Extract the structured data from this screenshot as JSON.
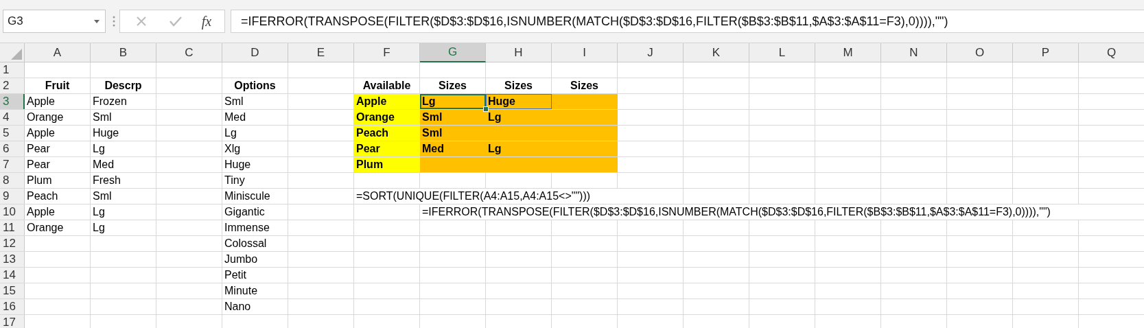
{
  "name_box": {
    "value": "G3"
  },
  "formula_bar": {
    "fx_label": "fx",
    "value": "=IFERROR(TRANSPOSE(FILTER($D$3:$D$16,ISNUMBER(MATCH($D$3:$D$16,FILTER($B$3:$B$11,$A$3:$A$11=F3),0)))),\"\")"
  },
  "columns": [
    {
      "label": "A",
      "selected": false
    },
    {
      "label": "B",
      "selected": false
    },
    {
      "label": "C",
      "selected": false
    },
    {
      "label": "D",
      "selected": false
    },
    {
      "label": "E",
      "selected": false
    },
    {
      "label": "F",
      "selected": false
    },
    {
      "label": "G",
      "selected": true
    },
    {
      "label": "H",
      "selected": false
    },
    {
      "label": "I",
      "selected": false
    },
    {
      "label": "J",
      "selected": false
    },
    {
      "label": "K",
      "selected": false
    },
    {
      "label": "L",
      "selected": false
    },
    {
      "label": "M",
      "selected": false
    },
    {
      "label": "N",
      "selected": false
    },
    {
      "label": "O",
      "selected": false
    },
    {
      "label": "P",
      "selected": false
    },
    {
      "label": "Q",
      "selected": false
    }
  ],
  "rows": [
    {
      "number": "1",
      "selected": false,
      "cells": [
        null,
        null,
        null,
        null,
        null,
        null,
        null,
        null,
        null,
        null,
        null,
        null,
        null,
        null,
        null,
        null,
        null
      ]
    },
    {
      "number": "2",
      "selected": false,
      "cells": [
        {
          "text": "Fruit",
          "bold": true,
          "centered": true
        },
        {
          "text": "Descrp",
          "bold": true,
          "centered": true
        },
        null,
        {
          "text": "Options",
          "bold": true,
          "centered": true
        },
        null,
        {
          "text": "Available",
          "bold": true,
          "centered": true
        },
        {
          "text": "Sizes",
          "bold": true,
          "centered": true
        },
        {
          "text": "Sizes",
          "bold": true,
          "centered": true
        },
        {
          "text": "Sizes",
          "bold": true,
          "centered": true
        },
        null,
        null,
        null,
        null,
        null,
        null,
        null,
        null
      ]
    },
    {
      "number": "3",
      "selected": true,
      "cells": [
        {
          "text": "Apple"
        },
        {
          "text": "Frozen"
        },
        null,
        {
          "text": "Sml"
        },
        null,
        {
          "text": "Apple",
          "bold": true,
          "color": "#ffff00"
        },
        {
          "text": "Lg",
          "bold": true,
          "color": "#ffc000",
          "selected": true
        },
        {
          "text": "Huge",
          "bold": true,
          "color": "#ffc000",
          "selected": false,
          "highlighted": true
        },
        {
          "color": "#ffc000"
        },
        null,
        null,
        null,
        null,
        null,
        null,
        null,
        null
      ]
    },
    {
      "number": "4",
      "selected": false,
      "cells": [
        {
          "text": "Orange"
        },
        {
          "text": "Sml"
        },
        null,
        {
          "text": "Med"
        },
        null,
        {
          "text": "Orange",
          "bold": true,
          "color": "#ffff00"
        },
        {
          "text": "Sml",
          "bold": true,
          "color": "#ffc000"
        },
        {
          "text": "Lg",
          "bold": true,
          "color": "#ffc000"
        },
        {
          "color": "#ffc000"
        },
        null,
        null,
        null,
        null,
        null,
        null,
        null,
        null
      ]
    },
    {
      "number": "5",
      "selected": false,
      "cells": [
        {
          "text": "Apple"
        },
        {
          "text": "Huge"
        },
        null,
        {
          "text": "Lg"
        },
        null,
        {
          "text": "Peach",
          "bold": true,
          "color": "#ffff00"
        },
        {
          "text": "Sml",
          "bold": true,
          "color": "#ffc000"
        },
        {
          "color": "#ffc000"
        },
        {
          "color": "#ffc000"
        },
        null,
        null,
        null,
        null,
        null,
        null,
        null,
        null
      ]
    },
    {
      "number": "6",
      "selected": false,
      "cells": [
        {
          "text": "Pear"
        },
        {
          "text": "Lg"
        },
        null,
        {
          "text": "Xlg"
        },
        null,
        {
          "text": "Pear",
          "bold": true,
          "color": "#ffff00"
        },
        {
          "text": "Med",
          "bold": true,
          "color": "#ffc000"
        },
        {
          "text": "Lg",
          "bold": true,
          "color": "#ffc000"
        },
        {
          "color": "#ffc000"
        },
        null,
        null,
        null,
        null,
        null,
        null,
        null,
        null
      ]
    },
    {
      "number": "7",
      "selected": false,
      "cells": [
        {
          "text": "Pear"
        },
        {
          "text": "Med"
        },
        null,
        {
          "text": "Huge"
        },
        null,
        {
          "text": "Plum",
          "bold": true,
          "color": "#ffff00"
        },
        {
          "color": "#ffc000"
        },
        {
          "color": "#ffc000"
        },
        {
          "color": "#ffc000"
        },
        null,
        null,
        null,
        null,
        null,
        null,
        null,
        null
      ]
    },
    {
      "number": "8",
      "selected": false,
      "cells": [
        {
          "text": "Plum"
        },
        {
          "text": "Fresh"
        },
        null,
        {
          "text": "Tiny"
        },
        null,
        null,
        null,
        null,
        null,
        null,
        null,
        null,
        null,
        null,
        null,
        null,
        null
      ]
    },
    {
      "number": "9",
      "selected": false,
      "cells": [
        {
          "text": "Peach"
        },
        {
          "text": "Sml"
        },
        null,
        {
          "text": "Miniscule"
        },
        null,
        {
          "text": "=SORT(UNIQUE(FILTER(A4:A15,A4:A15<>\"\")))"
        },
        null,
        null,
        null,
        null,
        null,
        null,
        null,
        null,
        null,
        null,
        null
      ]
    },
    {
      "number": "10",
      "selected": false,
      "cells": [
        {
          "text": "Apple"
        },
        {
          "text": "Lg"
        },
        null,
        {
          "text": "Gigantic"
        },
        null,
        null,
        {
          "text": "=IFERROR(TRANSPOSE(FILTER($D$3:$D$16,ISNUMBER(MATCH($D$3:$D$16,FILTER($B$3:$B$11,$A$3:$A$11=F3),0)))),\"\")"
        },
        null,
        null,
        null,
        null,
        null,
        null,
        null,
        null,
        null,
        null
      ]
    },
    {
      "number": "11",
      "selected": false,
      "cells": [
        {
          "text": "Orange"
        },
        {
          "text": "Lg"
        },
        null,
        {
          "text": "Immense"
        },
        null,
        null,
        null,
        null,
        null,
        null,
        null,
        null,
        null,
        null,
        null,
        null,
        null
      ]
    },
    {
      "number": "12",
      "selected": false,
      "cells": [
        null,
        null,
        null,
        {
          "text": "Colossal"
        },
        null,
        null,
        null,
        null,
        null,
        null,
        null,
        null,
        null,
        null,
        null,
        null,
        null
      ]
    },
    {
      "number": "13",
      "selected": false,
      "cells": [
        null,
        null,
        null,
        {
          "text": "Jumbo"
        },
        null,
        null,
        null,
        null,
        null,
        null,
        null,
        null,
        null,
        null,
        null,
        null,
        null
      ]
    },
    {
      "number": "14",
      "selected": false,
      "cells": [
        null,
        null,
        null,
        {
          "text": "Petit"
        },
        null,
        null,
        null,
        null,
        null,
        null,
        null,
        null,
        null,
        null,
        null,
        null,
        null
      ]
    },
    {
      "number": "15",
      "selected": false,
      "cells": [
        null,
        null,
        null,
        {
          "text": "Minute"
        },
        null,
        null,
        null,
        null,
        null,
        null,
        null,
        null,
        null,
        null,
        null,
        null,
        null
      ]
    },
    {
      "number": "16",
      "selected": false,
      "cells": [
        null,
        null,
        null,
        {
          "text": "Nano"
        },
        null,
        null,
        null,
        null,
        null,
        null,
        null,
        null,
        null,
        null,
        null,
        null,
        null
      ]
    },
    {
      "number": "17",
      "selected": false,
      "cells": [
        null,
        null,
        null,
        null,
        null,
        null,
        null,
        null,
        null,
        null,
        null,
        null,
        null,
        null,
        null,
        null,
        null
      ]
    }
  ]
}
